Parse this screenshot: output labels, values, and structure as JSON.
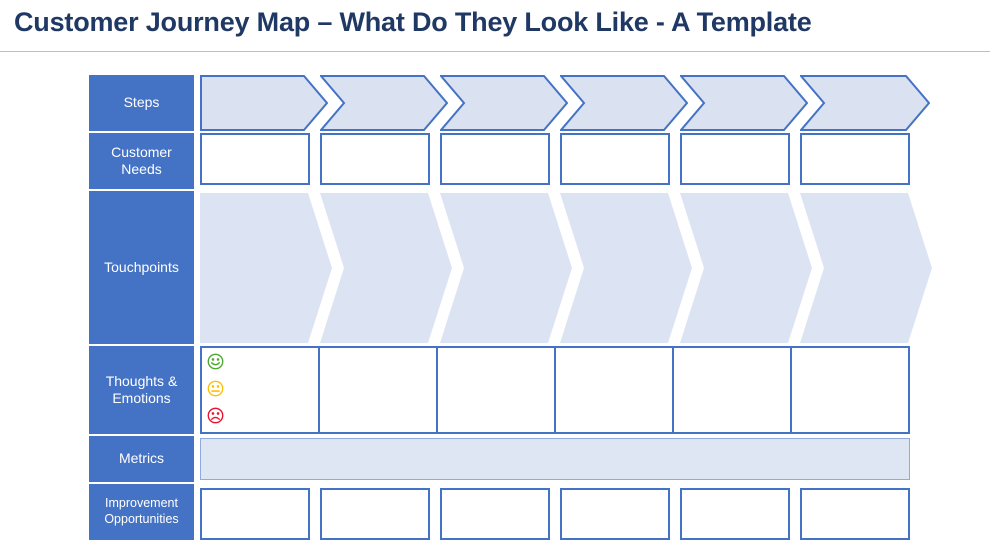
{
  "header": {
    "title": "Customer Journey Map – What Do They Look Like - A Template"
  },
  "colors": {
    "title_navy": "#1F3864",
    "label_blue": "#4472C4",
    "chevron_fill": "#DAE1F1",
    "chevron_stroke": "#4472C4",
    "touchpoint_fill": "#DCE3F2",
    "metrics_fill": "#DEE6F4",
    "metrics_stroke": "#8FAADC",
    "box_white": "#FFFFFF",
    "divider_gray": "#BFBFBF",
    "emotion_happy": "#4EA72E",
    "emotion_neutral": "#FFC000",
    "emotion_sad": "#E8102A"
  },
  "rows": [
    {
      "key": "steps",
      "label": "Steps",
      "type": "chevron-outlined",
      "columns": 6,
      "small": false
    },
    {
      "key": "needs",
      "label": "Customer Needs",
      "type": "box-white",
      "columns": 6,
      "small": false
    },
    {
      "key": "touchpoints",
      "label": "Touchpoints",
      "type": "chevron-filled",
      "columns": 6,
      "small": false
    },
    {
      "key": "emotions",
      "label": "Thoughts & Emotions",
      "type": "emotion-cells",
      "columns": 6,
      "small": false
    },
    {
      "key": "metrics",
      "label": "Metrics",
      "type": "single-bar",
      "columns": 1,
      "small": false
    },
    {
      "key": "improvement",
      "label": "Improvement Opportunities",
      "type": "box-white",
      "columns": 6,
      "small": true
    }
  ],
  "emotions_legend": [
    {
      "name": "happy-face-icon",
      "mood": "happy"
    },
    {
      "name": "neutral-face-icon",
      "mood": "neutral"
    },
    {
      "name": "sad-face-icon",
      "mood": "sad"
    }
  ],
  "cell_values": {
    "steps": [
      "",
      "",
      "",
      "",
      "",
      ""
    ],
    "needs": [
      "",
      "",
      "",
      "",
      "",
      ""
    ],
    "touchpoints": [
      "",
      "",
      "",
      "",
      "",
      ""
    ],
    "emotions": [
      "",
      "",
      "",
      "",
      "",
      ""
    ],
    "metrics": [
      ""
    ],
    "improvement": [
      "",
      "",
      "",
      "",
      "",
      ""
    ]
  }
}
